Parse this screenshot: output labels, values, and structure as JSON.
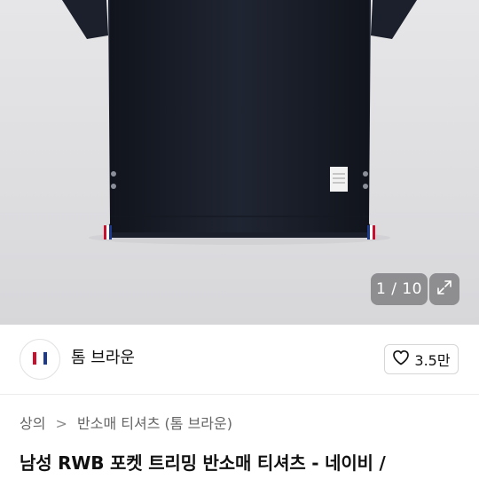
{
  "gallery": {
    "counter_text": "1 / 10",
    "expand_icon": "expand-arrows-icon",
    "shirt_color": "#1a1f2b",
    "background_color": "#e0e0e2"
  },
  "brand": {
    "logo_icon": "tricolor-stripe-logo",
    "name": "톰 브라운",
    "like_icon": "heart-outline-icon",
    "like_count": "3.5만"
  },
  "breadcrumb": {
    "items": [
      "상의",
      "반소매 티셔츠 (톰 브라운)"
    ],
    "separator": ">"
  },
  "product": {
    "title": "남성 RWB 포켓 트리밍 반소매 티셔츠 - 네이비 /"
  }
}
